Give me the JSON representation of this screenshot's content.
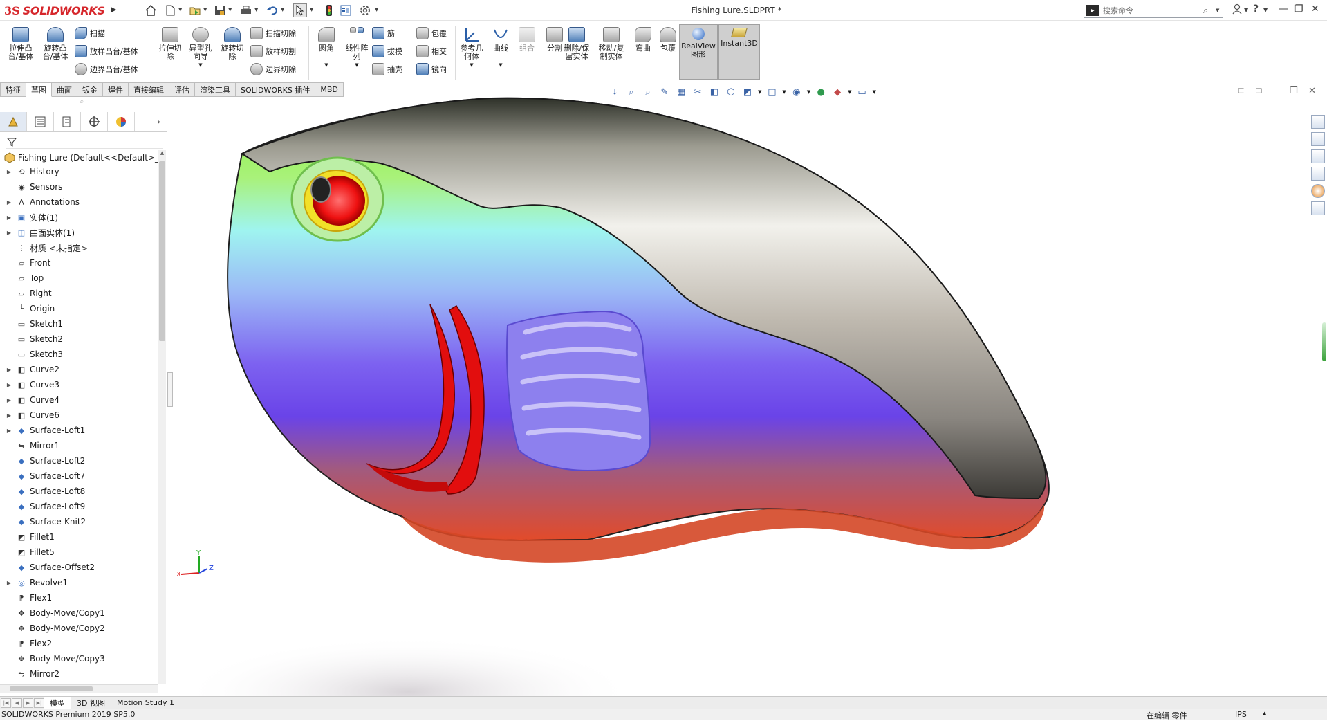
{
  "app": {
    "brand_ds": "3S",
    "brand_name": "SOLIDWORKS",
    "document_title": "Fishing Lure.SLDPRT *",
    "search_placeholder": "搜索命令"
  },
  "command_manager": {
    "features": [
      {
        "label": "拉伸凸\n台/基体"
      },
      {
        "label": "旋转凸\n台/基体"
      }
    ],
    "features_small": [
      "扫描",
      "放样凸台/基体",
      "边界凸台/基体"
    ],
    "cut_big": [
      {
        "label": "拉伸切\n除"
      },
      {
        "label": "异型孔\n向导"
      },
      {
        "label": "旋转切\n除"
      }
    ],
    "cut_small": [
      "扫描切除",
      "放样切割",
      "边界切除"
    ],
    "fillet_big": [
      {
        "label": "圆角"
      },
      {
        "label": "线性阵\n列"
      }
    ],
    "fillet_small_col1": [
      "筋",
      "拔模",
      "抽壳"
    ],
    "fillet_small_col2": [
      "包覆",
      "相交",
      "镜向"
    ],
    "ref_big": [
      {
        "label": "参考几\n何体"
      },
      {
        "label": "曲线"
      }
    ],
    "solid_big": [
      {
        "label": "组合"
      },
      {
        "label": "分割"
      },
      {
        "label": "删除/保\n留实体"
      },
      {
        "label": "移动/复\n制实体"
      },
      {
        "label": "弯曲"
      },
      {
        "label": "包覆"
      },
      {
        "label": "RealView\n图形"
      },
      {
        "label": "Instant3D"
      }
    ]
  },
  "tabs": [
    "特征",
    "草图",
    "曲面",
    "钣金",
    "焊件",
    "直接编辑",
    "评估",
    "渲染工具",
    "SOLIDWORKS 插件",
    "MBD"
  ],
  "active_tab": "草图",
  "feature_tree": {
    "root": "Fishing Lure  (Default<<Default>_",
    "items": [
      {
        "label": "History",
        "expandable": true,
        "icon": "history-icon"
      },
      {
        "label": "Sensors",
        "expandable": false,
        "icon": "sensor-icon"
      },
      {
        "label": "Annotations",
        "expandable": true,
        "icon": "annotation-icon"
      },
      {
        "label": "实体(1)",
        "expandable": true,
        "icon": "solid-body-icon"
      },
      {
        "label": "曲面实体(1)",
        "expandable": true,
        "icon": "surface-body-icon"
      },
      {
        "label": "材质 <未指定>",
        "expandable": false,
        "icon": "material-icon"
      },
      {
        "label": "Front",
        "expandable": false,
        "icon": "plane-icon"
      },
      {
        "label": "Top",
        "expandable": false,
        "icon": "plane-icon"
      },
      {
        "label": "Right",
        "expandable": false,
        "icon": "plane-icon"
      },
      {
        "label": "Origin",
        "expandable": false,
        "icon": "origin-icon"
      },
      {
        "label": "Sketch1",
        "expandable": false,
        "icon": "sketch-icon"
      },
      {
        "label": "Sketch2",
        "expandable": false,
        "icon": "sketch-icon"
      },
      {
        "label": "Sketch3",
        "expandable": false,
        "icon": "sketch-icon"
      },
      {
        "label": "Curve2",
        "expandable": true,
        "icon": "curve-icon"
      },
      {
        "label": "Curve3",
        "expandable": true,
        "icon": "curve-icon"
      },
      {
        "label": "Curve4",
        "expandable": true,
        "icon": "curve-icon"
      },
      {
        "label": "Curve6",
        "expandable": true,
        "icon": "curve-icon"
      },
      {
        "label": "Surface-Loft1",
        "expandable": true,
        "icon": "loft-icon"
      },
      {
        "label": "Mirror1",
        "expandable": false,
        "icon": "mirror-icon"
      },
      {
        "label": "Surface-Loft2",
        "expandable": false,
        "icon": "loft-icon"
      },
      {
        "label": "Surface-Loft7",
        "expandable": false,
        "icon": "loft-icon"
      },
      {
        "label": "Surface-Loft8",
        "expandable": false,
        "icon": "loft-icon"
      },
      {
        "label": "Surface-Loft9",
        "expandable": false,
        "icon": "loft-icon"
      },
      {
        "label": "Surface-Knit2",
        "expandable": false,
        "icon": "knit-icon"
      },
      {
        "label": "Fillet1",
        "expandable": false,
        "icon": "fillet-icon"
      },
      {
        "label": "Fillet5",
        "expandable": false,
        "icon": "fillet-icon"
      },
      {
        "label": "Surface-Offset2",
        "expandable": false,
        "icon": "offset-icon"
      },
      {
        "label": "Revolve1",
        "expandable": true,
        "icon": "revolve-icon"
      },
      {
        "label": "Flex1",
        "expandable": false,
        "icon": "flex-icon"
      },
      {
        "label": "Body-Move/Copy1",
        "expandable": false,
        "icon": "move-copy-icon"
      },
      {
        "label": "Body-Move/Copy2",
        "expandable": false,
        "icon": "move-copy-icon"
      },
      {
        "label": "Flex2",
        "expandable": false,
        "icon": "flex-icon"
      },
      {
        "label": "Body-Move/Copy3",
        "expandable": false,
        "icon": "move-copy-icon"
      },
      {
        "label": "Mirror2",
        "expandable": false,
        "icon": "mirror-icon"
      }
    ]
  },
  "bottom_tabs": [
    "模型",
    "3D 视图",
    "Motion Study 1"
  ],
  "status": {
    "product": "SOLIDWORKS Premium 2019 SP5.0",
    "editing": "在编辑 零件",
    "units": "IPS"
  },
  "triad": {
    "x": "X",
    "y": "Y",
    "z": "Z"
  }
}
